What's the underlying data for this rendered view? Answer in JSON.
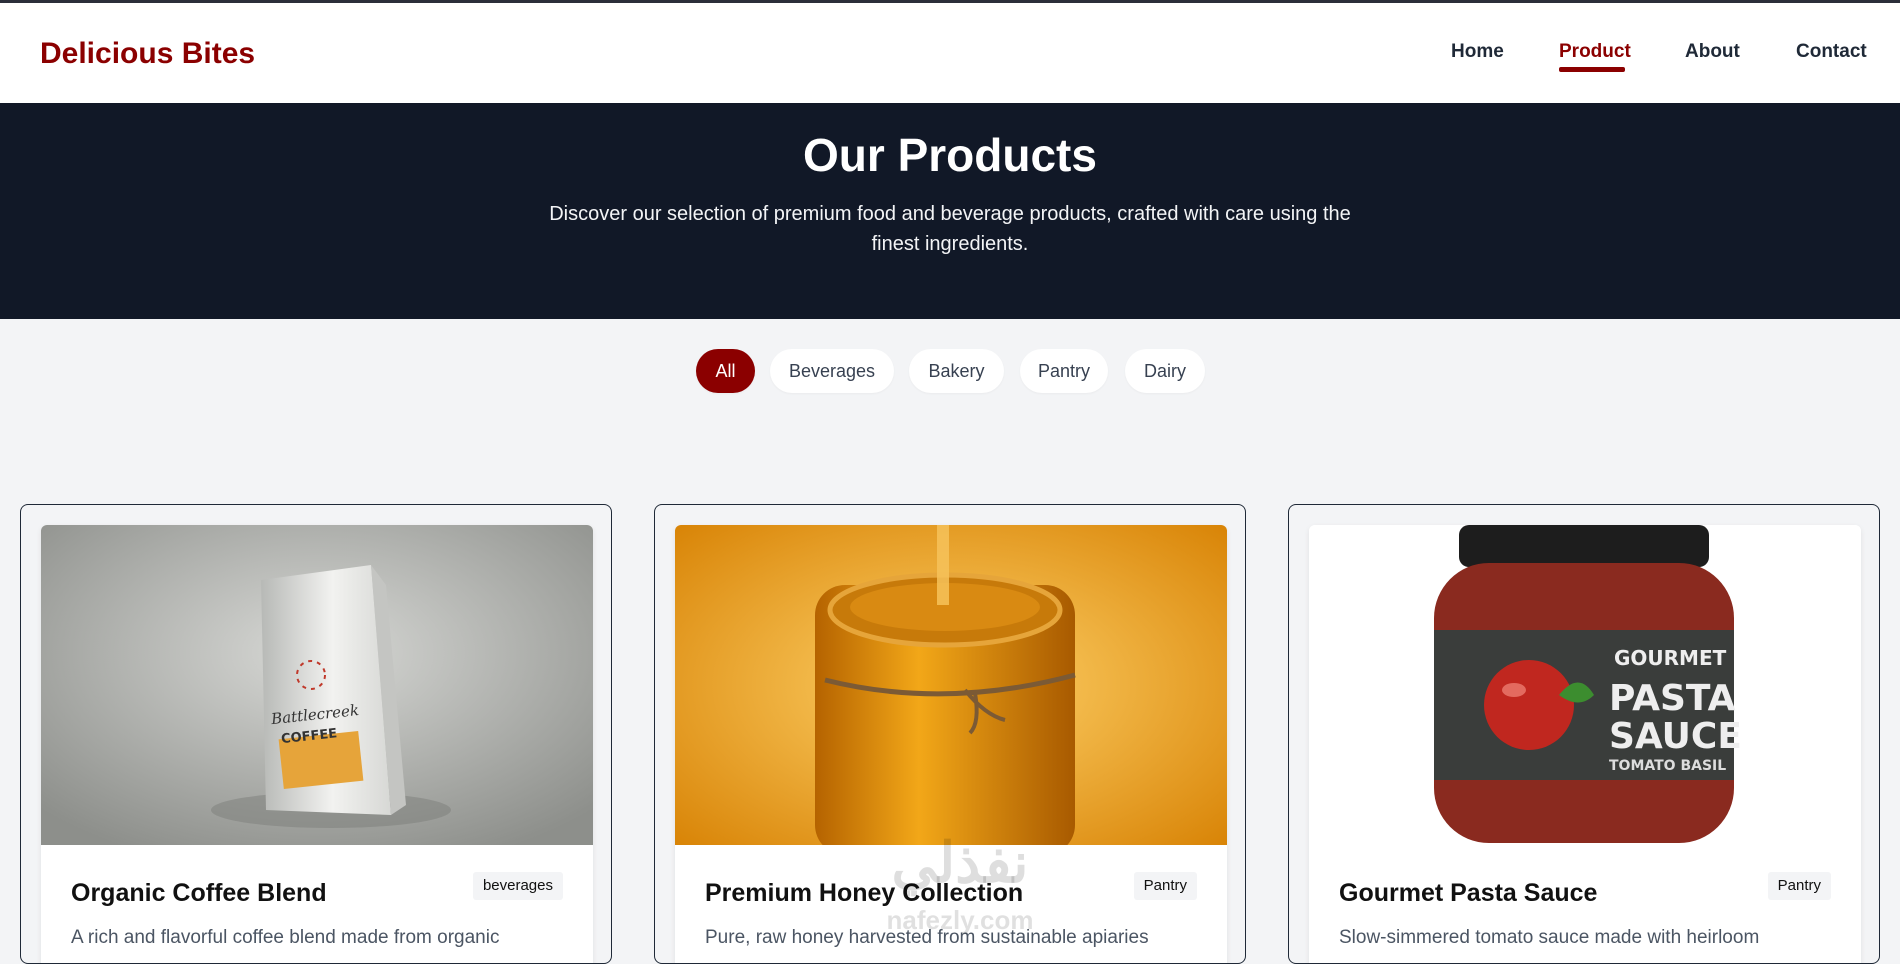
{
  "brand": {
    "name": "Delicious Bites",
    "color": "#8b0000"
  },
  "nav": {
    "items": [
      {
        "label": "Home"
      },
      {
        "label": "Product"
      },
      {
        "label": "About"
      },
      {
        "label": "Contact"
      }
    ],
    "active": "Product"
  },
  "hero": {
    "title": "Our Products",
    "description": "Discover our selection of premium food and beverage products, crafted with care using the finest ingredients."
  },
  "filters": {
    "items": [
      {
        "label": "All"
      },
      {
        "label": "Beverages"
      },
      {
        "label": "Bakery"
      },
      {
        "label": "Pantry"
      },
      {
        "label": "Dairy"
      }
    ],
    "active": "All"
  },
  "products": [
    {
      "name": "Organic Coffee Blend",
      "category": "beverages",
      "description": "A rich and flavorful coffee blend made from organic",
      "image": "coffee-bag-image"
    },
    {
      "name": "Premium Honey Collection",
      "category": "Pantry",
      "description": "Pure, raw honey harvested from sustainable apiaries",
      "image": "honey-jar-image"
    },
    {
      "name": "Gourmet Pasta Sauce",
      "category": "Pantry",
      "description": "Slow-simmered tomato sauce made with heirloom",
      "image": "pasta-sauce-jar-image"
    }
  ],
  "watermark": {
    "text": "نفذلي",
    "subtext": "nafezly.com"
  },
  "colors": {
    "accent": "#8b0000",
    "hero_bg": "#111827",
    "page_bg": "#f3f4f6"
  }
}
